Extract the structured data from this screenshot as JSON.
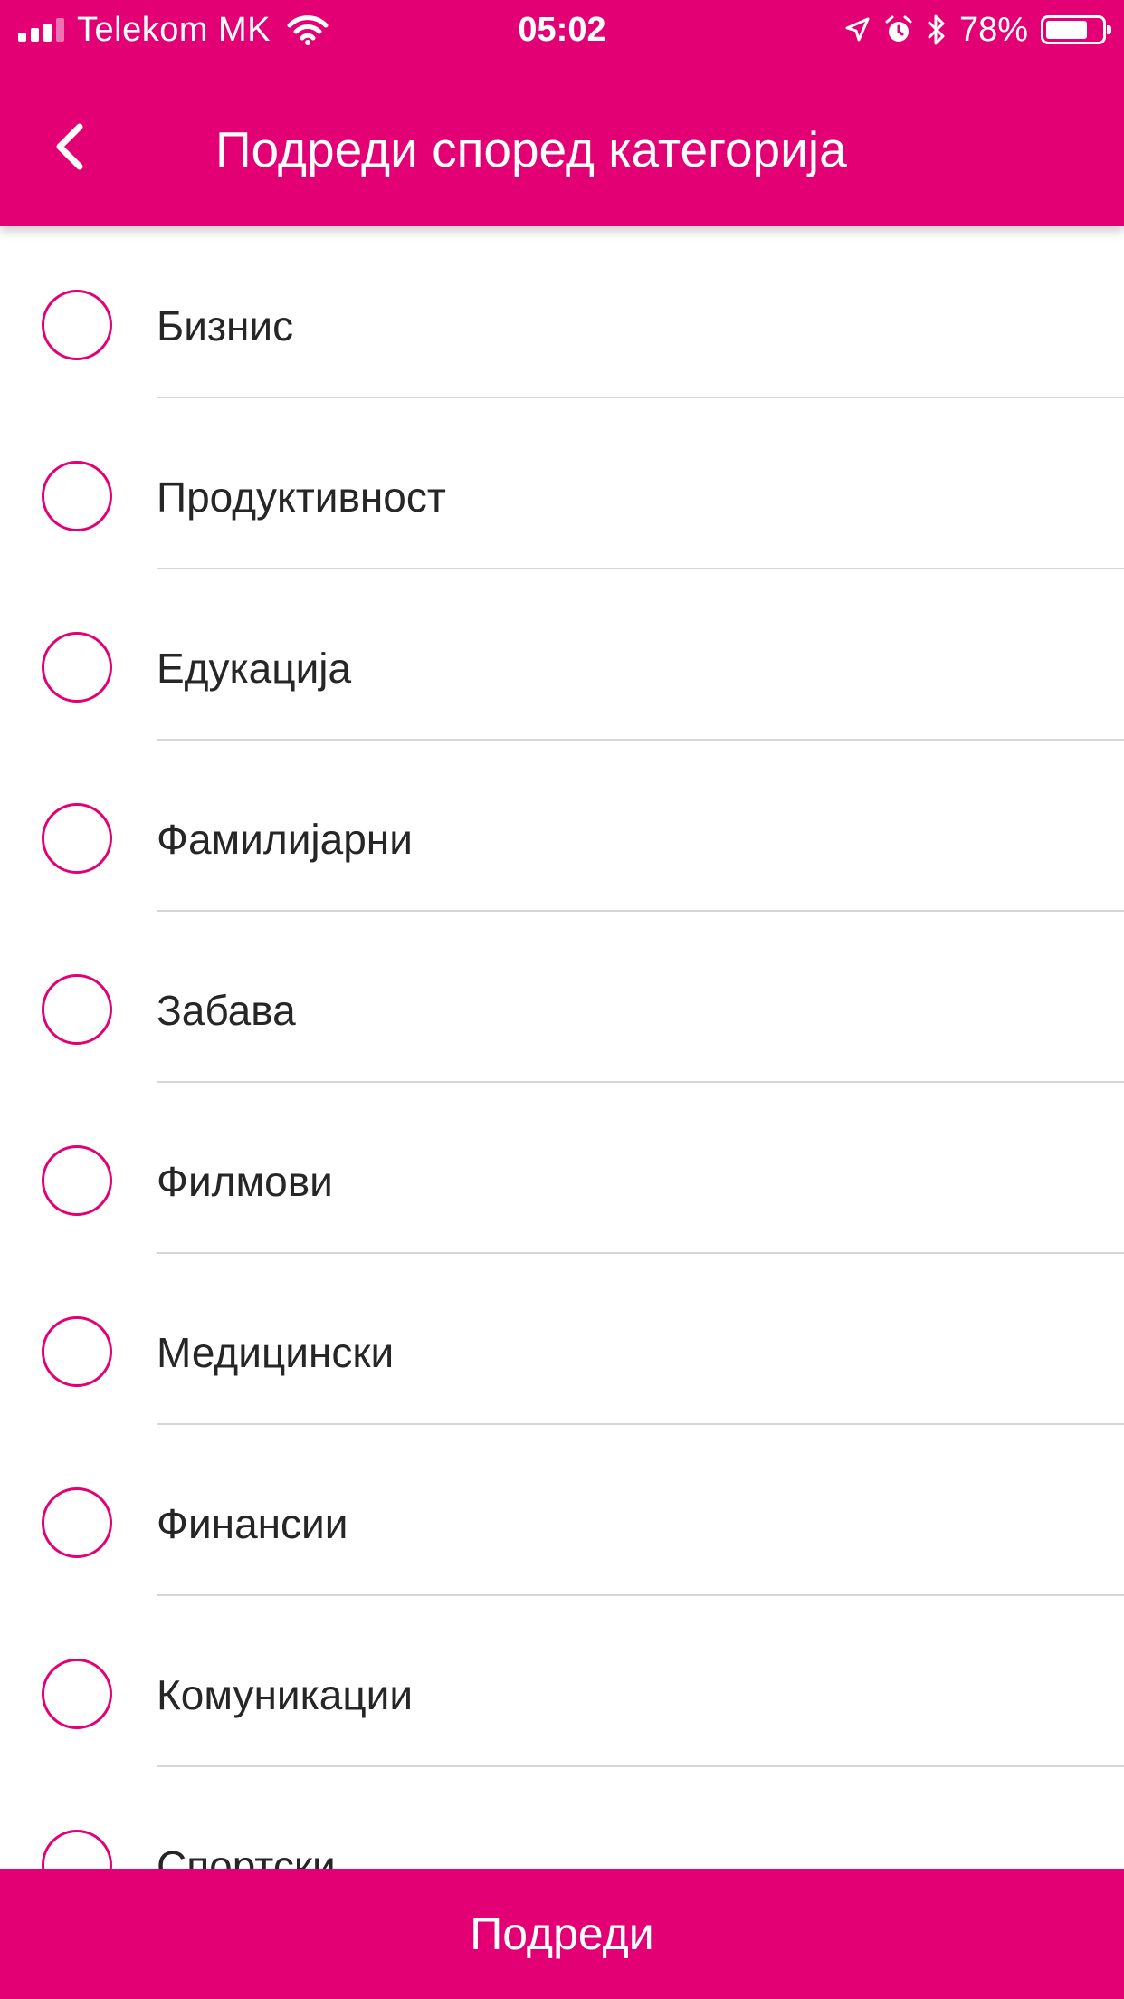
{
  "status_bar": {
    "carrier": "Telekom MK",
    "time": "05:02",
    "battery_percent": "78%",
    "battery_level": 0.78
  },
  "header": {
    "title": "Подреди според категорија",
    "back_icon": "chevron-left-icon"
  },
  "categories": [
    {
      "label": "Бизнис",
      "selected": false
    },
    {
      "label": "Продуктивност",
      "selected": false
    },
    {
      "label": "Едукација",
      "selected": false
    },
    {
      "label": "Фамилијарни",
      "selected": false
    },
    {
      "label": "Забава",
      "selected": false
    },
    {
      "label": "Филмови",
      "selected": false
    },
    {
      "label": "Медицински",
      "selected": false
    },
    {
      "label": "Финансии",
      "selected": false
    },
    {
      "label": "Комуникации",
      "selected": false
    },
    {
      "label": "Спортски",
      "selected": false
    }
  ],
  "footer": {
    "button_label": "Подреди"
  },
  "colors": {
    "accent": "#e20074",
    "text": "#262626",
    "divider": "#d6d6d6"
  }
}
